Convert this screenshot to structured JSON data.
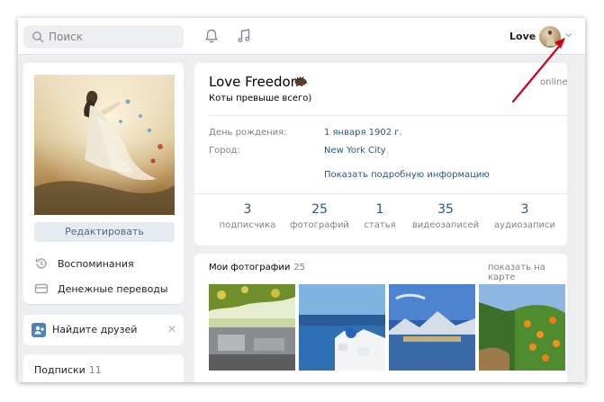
{
  "topbar": {
    "search_placeholder": "Поиск",
    "user_name": "Love"
  },
  "left": {
    "edit_button": "Редактировать",
    "links": [
      {
        "label": "Воспоминания",
        "icon": "clock-history-icon"
      },
      {
        "label": "Денежные переводы",
        "icon": "money-transfer-icon"
      }
    ],
    "find_friends": "Найдите друзей",
    "subscriptions_label": "Подписки",
    "subscriptions_count": "11"
  },
  "profile": {
    "name": "Love Freedom",
    "status": "Коты превыше всего)",
    "online": "online",
    "info": [
      {
        "key": "День рождения:",
        "value": "1 января 1902 г."
      },
      {
        "key": "Город:",
        "value": "New York City"
      }
    ],
    "more_info": "Показать подробную информацию",
    "counters": [
      {
        "num": "3",
        "label": "подписчика"
      },
      {
        "num": "25",
        "label": "фотографий"
      },
      {
        "num": "1",
        "label": "статья"
      },
      {
        "num": "35",
        "label": "видеозаписей"
      },
      {
        "num": "3",
        "label": "аудиозаписи"
      }
    ]
  },
  "photos": {
    "title": "Мои фотографии",
    "count": "25",
    "map_link": "показать на карте"
  },
  "colors": {
    "link": "#2a5885",
    "accent": "#5181b8",
    "background": "#edeef0",
    "annotation_arrow": "#d0021b"
  }
}
